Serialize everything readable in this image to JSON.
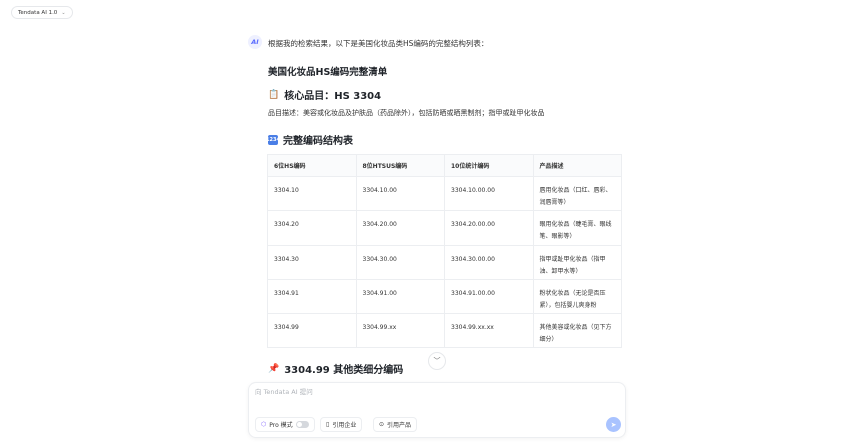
{
  "header": {
    "model_label": "Tendata AI 1.0"
  },
  "message": {
    "avatar": "AI",
    "intro": "根据我的检索结果，以下是美国化妆品类HS编码的完整结构列表：",
    "title": "美国化妆品HS编码完整清单",
    "core_heading": "核心品目：HS 3304",
    "description": "品目描述：美容或化妆品及护肤品（药品除外），包括防晒或晒黑制剂；指甲或趾甲化妆品",
    "table_heading": "完整编码结构表",
    "table": {
      "columns": [
        "6位HS编码",
        "8位HTSUS编码",
        "10位统计编码",
        "产品描述"
      ],
      "rows": [
        [
          "3304.10",
          "3304.10.00",
          "3304.10.00.00",
          "唇用化妆品（口红、唇彩、润唇膏等）"
        ],
        [
          "3304.20",
          "3304.20.00",
          "3304.20.00.00",
          "眼用化妆品（睫毛膏、眼线笔、眼影等）"
        ],
        [
          "3304.30",
          "3304.30.00",
          "3304.30.00.00",
          "指甲或趾甲化妆品（指甲油、卸甲水等）"
        ],
        [
          "3304.91",
          "3304.91.00",
          "3304.91.00.00",
          "粉状化妆品（无论是否压紧），包括婴儿爽身粉"
        ],
        [
          "3304.99",
          "3304.99.xx",
          "3304.99.xx.xx",
          "其他美容或化妆品（见下方细分）"
        ]
      ]
    },
    "sub_heading": "3304.99 其他类细分编码"
  },
  "composer": {
    "placeholder": "向 Tendata AI 提问",
    "pro_label": "Pro 模式",
    "pro_enabled": false,
    "cite_company": "引用企业",
    "cite_product": "引用产品"
  },
  "colors": {
    "accent": "#5b6cff",
    "send": "#a9c3ff"
  }
}
